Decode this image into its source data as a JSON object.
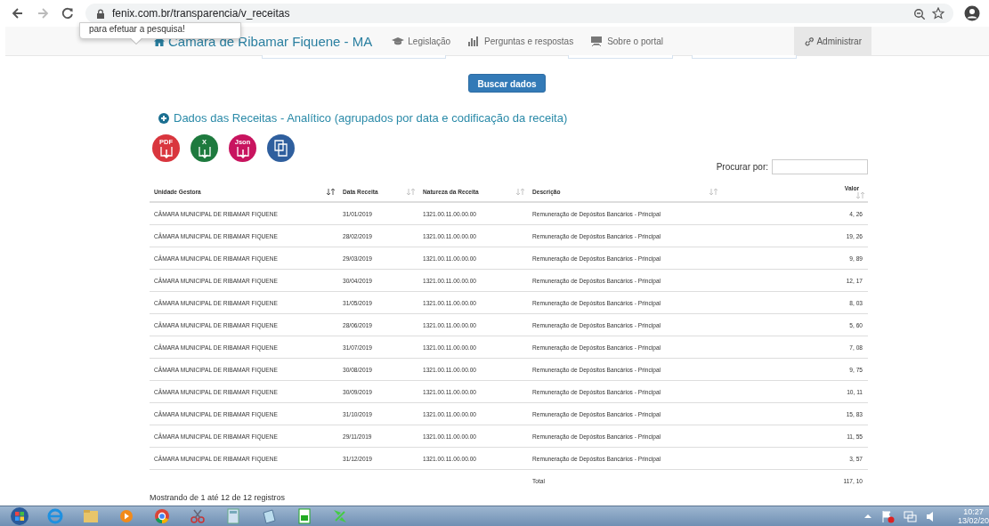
{
  "browser": {
    "url": "fenix.com.br/transparencia/v_receitas"
  },
  "tooltip": "para efetuar a pesquisa!",
  "nav": {
    "brand": "Câmara de Ribamar Fiquene - MA",
    "links": [
      "Legislação",
      "Perguntas e respostas",
      "Sobre o portal"
    ],
    "admin": "Administrar"
  },
  "search_button": "Buscar dados",
  "section_title": "Dados das Receitas - Analítico (agrupados por data e codificação da receita)",
  "exports": [
    {
      "kind": "pdf",
      "label": "PDF"
    },
    {
      "kind": "excel",
      "label": "X"
    },
    {
      "kind": "json",
      "label": "Json"
    },
    {
      "kind": "copy"
    }
  ],
  "search_label": "Procurar por:",
  "table": {
    "columns": [
      {
        "label": "Unidade Gestora",
        "sorted": true
      },
      {
        "label": "Data Receita",
        "sorted": false
      },
      {
        "label": "Natureza da Receita",
        "sorted": false
      },
      {
        "label": "Descrição",
        "sorted": false
      },
      {
        "label": "Valor",
        "sorted": false
      }
    ],
    "rows": [
      [
        "CÂMARA MUNICIPAL DE RIBAMAR FIQUENE",
        "31/01/2019",
        "1321.00.11.00.00.00",
        "Remuneração de Depósitos Bancários - Principal",
        "4, 26"
      ],
      [
        "CÂMARA MUNICIPAL DE RIBAMAR FIQUENE",
        "28/02/2019",
        "1321.00.11.00.00.00",
        "Remuneração de Depósitos Bancários - Principal",
        "19, 26"
      ],
      [
        "CÂMARA MUNICIPAL DE RIBAMAR FIQUENE",
        "29/03/2019",
        "1321.00.11.00.00.00",
        "Remuneração de Depósitos Bancários - Principal",
        "9, 89"
      ],
      [
        "CÂMARA MUNICIPAL DE RIBAMAR FIQUENE",
        "30/04/2019",
        "1321.00.11.00.00.00",
        "Remuneração de Depósitos Bancários - Principal",
        "12, 17"
      ],
      [
        "CÂMARA MUNICIPAL DE RIBAMAR FIQUENE",
        "31/05/2019",
        "1321.00.11.00.00.00",
        "Remuneração de Depósitos Bancários - Principal",
        "8, 03"
      ],
      [
        "CÂMARA MUNICIPAL DE RIBAMAR FIQUENE",
        "28/06/2019",
        "1321.00.11.00.00.00",
        "Remuneração de Depósitos Bancários - Principal",
        "5, 60"
      ],
      [
        "CÂMARA MUNICIPAL DE RIBAMAR FIQUENE",
        "31/07/2019",
        "1321.00.11.00.00.00",
        "Remuneração de Depósitos Bancários - Principal",
        "7, 08"
      ],
      [
        "CÂMARA MUNICIPAL DE RIBAMAR FIQUENE",
        "30/08/2019",
        "1321.00.11.00.00.00",
        "Remuneração de Depósitos Bancários - Principal",
        "9, 75"
      ],
      [
        "CÂMARA MUNICIPAL DE RIBAMAR FIQUENE",
        "30/09/2019",
        "1321.00.11.00.00.00",
        "Remuneração de Depósitos Bancários - Principal",
        "10, 11"
      ],
      [
        "CÂMARA MUNICIPAL DE RIBAMAR FIQUENE",
        "31/10/2019",
        "1321.00.11.00.00.00",
        "Remuneração de Depósitos Bancários - Principal",
        "15, 83"
      ],
      [
        "CÂMARA MUNICIPAL DE RIBAMAR FIQUENE",
        "29/11/2019",
        "1321.00.11.00.00.00",
        "Remuneração de Depósitos Bancários - Principal",
        "11, 55"
      ],
      [
        "CÂMARA MUNICIPAL DE RIBAMAR FIQUENE",
        "31/12/2019",
        "1321.00.11.00.00.00",
        "Remuneração de Depósitos Bancários - Principal",
        "3, 57"
      ]
    ],
    "total": {
      "label": "Total",
      "value": "117, 10"
    }
  },
  "footer_info": "Mostrando de 1 até 12 de 12 registros",
  "taskbar": {
    "time": "10:27",
    "date": "13/02/20"
  }
}
